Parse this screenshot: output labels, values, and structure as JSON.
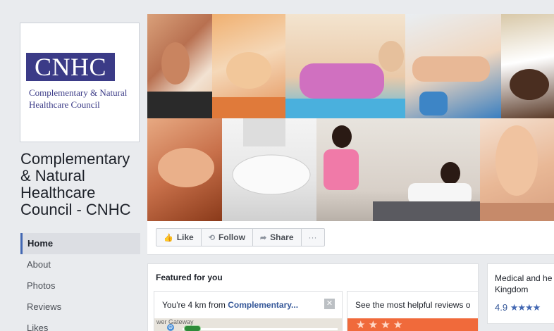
{
  "profile": {
    "logo_text": "CNHC",
    "logo_subtitle": "Complementary & Natural\nHealthcare Council",
    "page_name": "Complementary & Natural Healthcare Council - CNHC"
  },
  "nav": {
    "items": [
      {
        "label": "Home",
        "active": true
      },
      {
        "label": "About"
      },
      {
        "label": "Photos"
      },
      {
        "label": "Reviews"
      },
      {
        "label": "Likes"
      }
    ]
  },
  "actions": {
    "like": "Like",
    "follow": "Follow",
    "share": "Share",
    "more": "···"
  },
  "featured": {
    "title": "Featured for you",
    "card1_prefix": "You're 4 km from ",
    "card1_link": "Complementary...",
    "card1_map_label": "wer Gateway",
    "card2_text": "See the most helpful reviews o"
  },
  "side": {
    "text_line1": "Medical and he",
    "text_line2": "Kingdom",
    "rating": "4.9",
    "stars": "★★★★"
  },
  "colors": {
    "brand_purple": "#3b3b87",
    "fb_blue": "#4267b2",
    "link_blue": "#365899",
    "background": "#e9ebee"
  }
}
